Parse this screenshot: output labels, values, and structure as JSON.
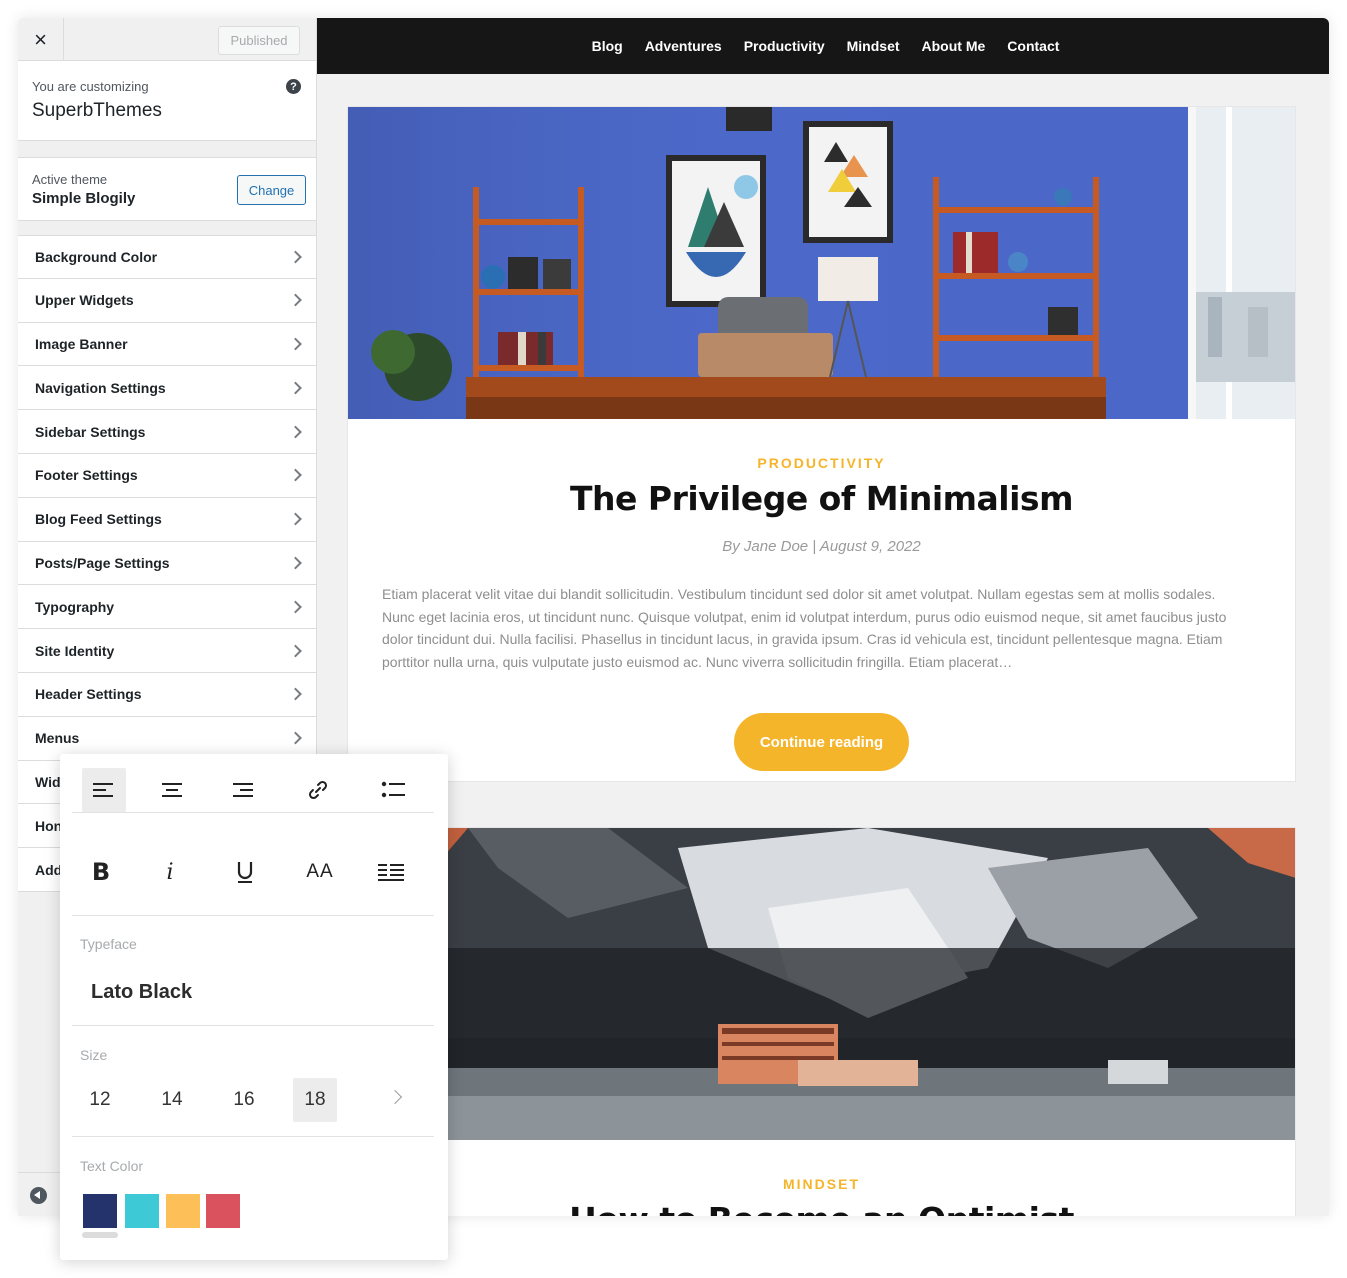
{
  "sidebar": {
    "close_label": "×",
    "publish_label": "Published",
    "customizing_label": "You are customizing",
    "site_name": "SuperbThemes",
    "help_label": "?",
    "active_theme_label": "Active theme",
    "theme_name": "Simple Blogily",
    "change_label": "Change",
    "items": [
      {
        "label": "Background Color"
      },
      {
        "label": "Upper Widgets"
      },
      {
        "label": "Image Banner"
      },
      {
        "label": "Navigation Settings"
      },
      {
        "label": "Sidebar Settings"
      },
      {
        "label": "Footer Settings"
      },
      {
        "label": "Blog Feed Settings"
      },
      {
        "label": "Posts/Page Settings"
      },
      {
        "label": "Typography"
      },
      {
        "label": "Site Identity"
      },
      {
        "label": "Header Settings"
      },
      {
        "label": "Menus"
      },
      {
        "label": "Wid"
      },
      {
        "label": "Hon"
      },
      {
        "label": "Add"
      }
    ]
  },
  "preview": {
    "nav": [
      {
        "label": "Blog"
      },
      {
        "label": "Adventures"
      },
      {
        "label": "Productivity"
      },
      {
        "label": "Mindset"
      },
      {
        "label": "About Me"
      },
      {
        "label": "Contact"
      }
    ],
    "post1": {
      "category": "PRODUCTIVITY",
      "title": "The Privilege of Minimalism",
      "meta": "By Jane Doe | August 9, 2022",
      "excerpt": "Etiam placerat velit vitae dui blandit sollicitudin. Vestibulum tincidunt sed dolor sit amet volutpat. Nullam egestas sem at mollis sodales. Nunc eget lacinia eros, ut tincidunt nunc. Quisque volutpat, enim id volutpat interdum, purus odio euismod neque, sit amet faucibus justo dolor tincidunt dui. Nulla facilisi. Phasellus in tincidunt lacus, in gravida ipsum. Cras id vehicula est, tincidunt pellentesque magna. Etiam porttitor nulla urna, quis vulputate justo euismod ac. Nunc viverra sollicitudin fringilla. Etiam placerat…",
      "button": "Continue reading"
    },
    "post2": {
      "category": "MINDSET",
      "title": "How to Become an Optimist"
    }
  },
  "toolbar": {
    "typeface_label": "Typeface",
    "typeface_value": "Lato Black",
    "size_label": "Size",
    "sizes": [
      "12",
      "14",
      "16",
      "18"
    ],
    "active_size": "18",
    "text_color_label": "Text Color",
    "aa_label": "AA",
    "colors": [
      "#24336b",
      "#3ec9d6",
      "#fdbf57",
      "#d9525e"
    ]
  }
}
